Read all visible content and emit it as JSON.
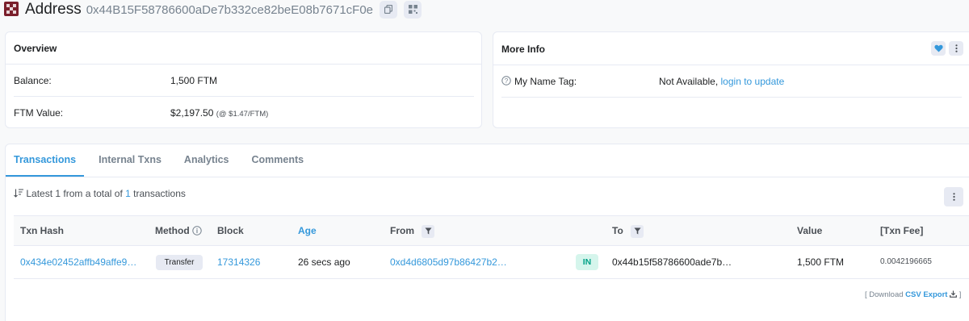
{
  "header": {
    "title": "Address",
    "address": "0x44B15F58786600aDe7b332ce82beE08b7671cF0e",
    "copy_icon": "copy-icon",
    "qr_icon": "qr-code-icon"
  },
  "overview": {
    "title": "Overview",
    "balance_label": "Balance:",
    "balance_value": "1,500 FTM",
    "value_label": "FTM Value:",
    "value_amount": "$2,197.50",
    "value_rate": "(@ $1.47/FTM)"
  },
  "more_info": {
    "title": "More Info",
    "name_tag_label": "My Name Tag:",
    "name_tag_value": "Not Available,",
    "name_tag_link": "login to update"
  },
  "tabs": [
    {
      "label": "Transactions",
      "active": true
    },
    {
      "label": "Internal Txns",
      "active": false
    },
    {
      "label": "Analytics",
      "active": false
    },
    {
      "label": "Comments",
      "active": false
    }
  ],
  "summary": {
    "prefix": "Latest",
    "count": "1",
    "middle": "from a total of",
    "total": "1",
    "suffix": "transactions"
  },
  "table": {
    "headers": {
      "txn_hash": "Txn Hash",
      "method": "Method",
      "block": "Block",
      "age": "Age",
      "from": "From",
      "to": "To",
      "value": "Value",
      "fee": "[Txn Fee]"
    },
    "rows": [
      {
        "txn_hash": "0x434e02452affb49affe9…",
        "method": "Transfer",
        "block": "17314326",
        "age": "26 secs ago",
        "from": "0xd4d6805d97b86427b2…",
        "direction": "IN",
        "to": "0x44b15f58786600ade7b…",
        "value": "1,500 FTM",
        "fee": "0.0042196665"
      }
    ]
  },
  "footer": {
    "open_bracket": "[ Download",
    "csv_label": "CSV Export",
    "close_bracket": "]"
  },
  "colors": {
    "accent": "#3498db",
    "in_badge_bg": "#d5f5ec",
    "in_badge_fg": "#00a186",
    "heart": "#3498db"
  }
}
